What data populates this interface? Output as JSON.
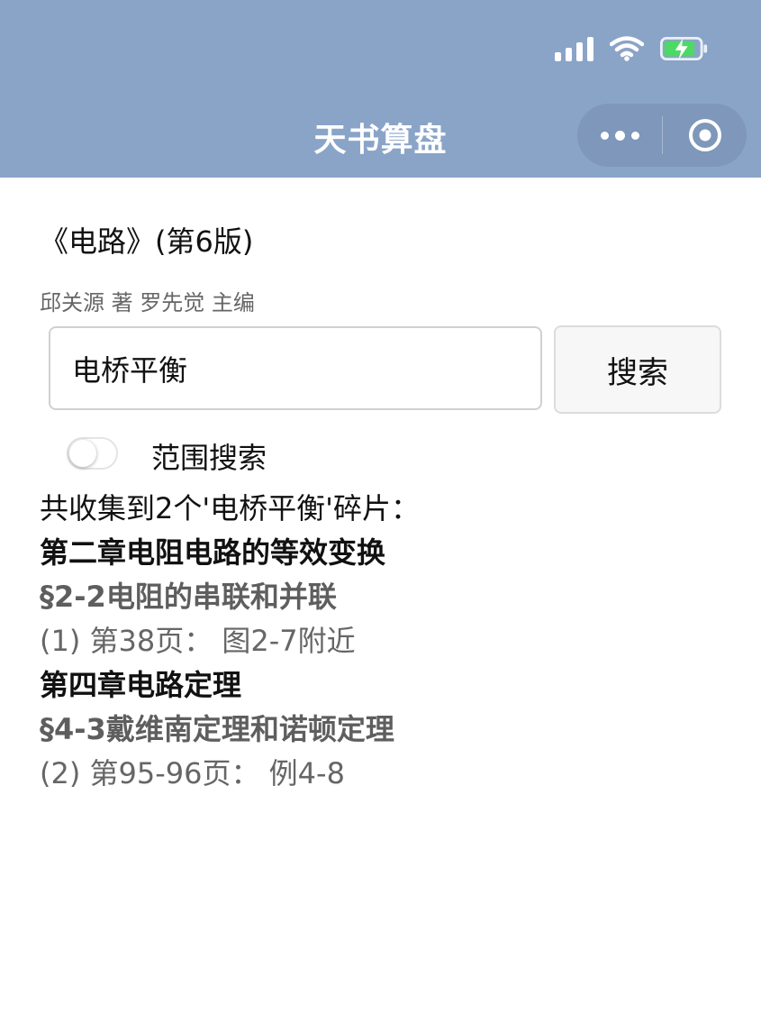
{
  "app": {
    "title": "天书算盘"
  },
  "capsule": {
    "more_icon": "more-dots-icon",
    "close_icon": "target-circle-icon"
  },
  "status_bar": {
    "icons": [
      "signal-icon",
      "wifi-icon",
      "battery-charging-icon"
    ],
    "battery_color": "#4cd964"
  },
  "colors": {
    "nav_bar": "#8aa4c8",
    "section_text": "#5e5e5e"
  },
  "book": {
    "title": "《电路》(第6版)",
    "authors": "邱关源 著 罗先觉 主编"
  },
  "search": {
    "value": "电桥平衡",
    "button_label": "搜索",
    "range_toggle_label": "范围搜索",
    "range_toggle_on": false
  },
  "results": {
    "summary": "共收集到2个'电桥平衡'碎片：",
    "groups": [
      {
        "chapter": "第二章电阻电路的等效变换",
        "section": "§2-2电阻的串联和并联",
        "ref": "(1) 第38页：  图2-7附近"
      },
      {
        "chapter": "第四章电路定理",
        "section": "§4-3戴维南定理和诺顿定理",
        "ref": "(2) 第95-96页：  例4-8"
      }
    ]
  }
}
